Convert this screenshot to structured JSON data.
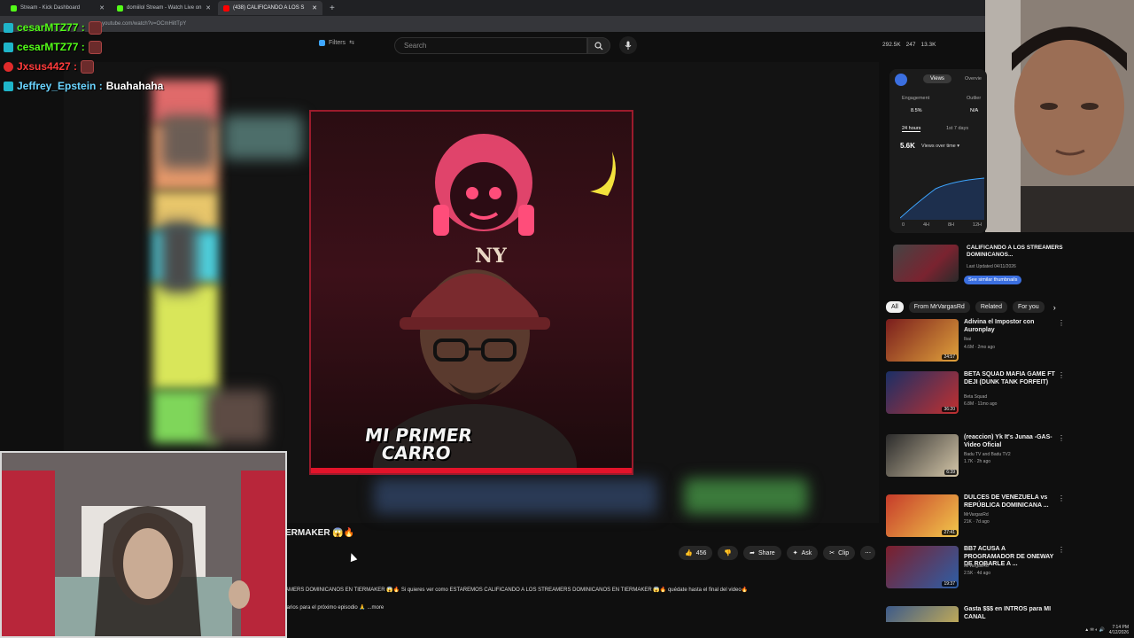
{
  "browser": {
    "tabs": [
      {
        "title": "Stream - Kick Dashboard",
        "color": "#53fc18"
      },
      {
        "title": "domiilol Stream - Watch Live on",
        "color": "#53fc18"
      },
      {
        "title": "(438) CALIFICANDO A LOS S",
        "color": "#ff0000"
      }
    ],
    "url": "youtube.com/watch?v=OCmHiltTpY"
  },
  "header": {
    "filters_label": "Filters",
    "search_placeholder": "Search",
    "stats": [
      "292.5K",
      "247",
      "13.3K"
    ]
  },
  "chat": [
    {
      "user": "cesarMTZ77 :",
      "color": "#53fc18"
    },
    {
      "user": "cesarMTZ77 :",
      "color": "#53fc18"
    },
    {
      "user": "Jxsus4427 :",
      "color": "#ff3b3b"
    },
    {
      "user": "Jeffrey_Epstein :",
      "message": "Buahahaha",
      "color": "#6ad4ff"
    }
  ],
  "video": {
    "overlay_line1": "MI PRIMER",
    "overlay_line2": "CARRO",
    "cap_logo": "NY",
    "title_partial": "ERMAKER 😱🔥",
    "description_line1": "AMERS DOMINICANOS EN TIERMAKER 😱🔥 Si quieres ver como ESTAREMOS CALIFICANDO A LOS STREAMERS DOMINICANOS EN TIERMAKER 😱🔥 quédate hasta el final del video🔥",
    "description_line2": "tarios para el próximo episodio 🙏 ...more",
    "likes": "456",
    "share_label": "Share",
    "ask_label": "Ask",
    "clip_label": "Clip"
  },
  "analytics": {
    "tab_views": "Views",
    "tab_overview": "Overvie",
    "engagement_label": "Engagement",
    "engagement_value": "8.5%",
    "outlier_label": "Outlier",
    "outlier_value": "N/A",
    "range_24h": "24 hours",
    "range_7d": "1st 7 days",
    "views_value": "5.6K",
    "views_dropdown": "Views over time ▾",
    "axis": [
      "0",
      "4H",
      "8H",
      "12H"
    ]
  },
  "playlist": {
    "title": "CALIFICANDO A LOS STREAMERS DOMINICANOS...",
    "meta": "Last Updated 04/11/2026",
    "button": "See similar thumbnails"
  },
  "chips": [
    "All",
    "From MrVargasRd",
    "Related",
    "For you"
  ],
  "recommendations": [
    {
      "title": "Adivina el Impostor con Auronplay",
      "channel": "Ibai",
      "meta": "4.6M · 2mo ago",
      "duration": "24:57",
      "colors": [
        "#7a1d1d",
        "#e0a23b"
      ]
    },
    {
      "title": "BETA SQUAD MAFIA GAME FT DEJI (DUNK TANK FORFEIT)",
      "channel": "Beta Squad",
      "meta": "6.8M · 11mo ago",
      "duration": "36:20",
      "colors": [
        "#1a2f66",
        "#c23030"
      ]
    },
    {
      "title": "(reaccion) Yk It's Junaa -GAS- Video Oficial",
      "channel": "Badu TV and Badu TV2",
      "meta": "1.7K · 2h ago",
      "duration": "6:39",
      "colors": [
        "#2b2b2b",
        "#d4c6a8"
      ]
    },
    {
      "title": "DULCES DE VENEZUELA vs REPÚBLICA DOMINICANA ...",
      "channel": "MrVargasRd",
      "meta": "21K · 7d ago",
      "duration": "27:41",
      "colors": [
        "#c63b2a",
        "#f2c84b"
      ]
    },
    {
      "title": "BB7 ACUSA A PROGRAMADOR DE ONEWAY DE ROBARLE A ...",
      "channel": "MrVargasRd",
      "meta": "2.5K · 4d ago",
      "duration": "19:37",
      "colors": [
        "#7d1e2b",
        "#2d5fa7"
      ]
    },
    {
      "title": "Gasta $$$ en INTROS para MI CANAL",
      "channel": "",
      "meta": "",
      "duration": "",
      "colors": [
        "#3c5a8a",
        "#e5c04a"
      ]
    }
  ],
  "system": {
    "time": "7:14 PM",
    "date": "4/12/2026"
  }
}
